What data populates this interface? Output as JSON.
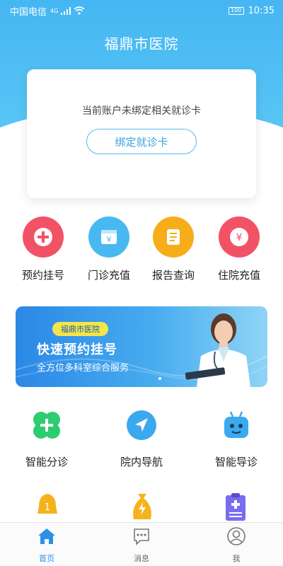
{
  "status_bar": {
    "carrier": "中国电信",
    "signal_label": "4G",
    "battery": "100",
    "time": "10:35"
  },
  "header": {
    "title": "福鼎市医院"
  },
  "card": {
    "message": "当前账户未绑定相关就诊卡",
    "bind_button": "绑定就诊卡"
  },
  "quick_actions": [
    {
      "label": "预约挂号",
      "icon": "plus-icon",
      "color": "#f25265"
    },
    {
      "label": "门诊充值",
      "icon": "yuan-card-icon",
      "color": "#48b9f0"
    },
    {
      "label": "报告查询",
      "icon": "document-icon",
      "color": "#f7ad1a"
    },
    {
      "label": "住院充值",
      "icon": "yuan-coin-icon",
      "color": "#f25265"
    }
  ],
  "banner": {
    "tag": "福鼎市医院",
    "title": "快速预约挂号",
    "subtitle": "全方位多科室综合服务"
  },
  "services": [
    {
      "label": "智能分诊",
      "icon": "clover-plus-icon",
      "color": "#2ecc71"
    },
    {
      "label": "院内导航",
      "icon": "navigation-arrow-icon",
      "color": "#3aa9ee"
    },
    {
      "label": "智能导诊",
      "icon": "robot-icon",
      "color": "#3aa9ee"
    }
  ],
  "more_services": [
    {
      "icon": "bell-icon",
      "badge": "1",
      "color": "#f5b21a"
    },
    {
      "icon": "money-bag-icon",
      "color": "#f5b21a"
    },
    {
      "icon": "clipboard-plus-icon",
      "color": "#7a6cf0"
    }
  ],
  "tabbar": [
    {
      "label": "首页",
      "icon": "home-icon",
      "active": true
    },
    {
      "label": "消息",
      "icon": "message-icon",
      "active": false
    },
    {
      "label": "我",
      "icon": "user-icon",
      "active": false
    }
  ],
  "colors": {
    "primary": "#45b6f2",
    "tab_active": "#2d8fe6"
  }
}
